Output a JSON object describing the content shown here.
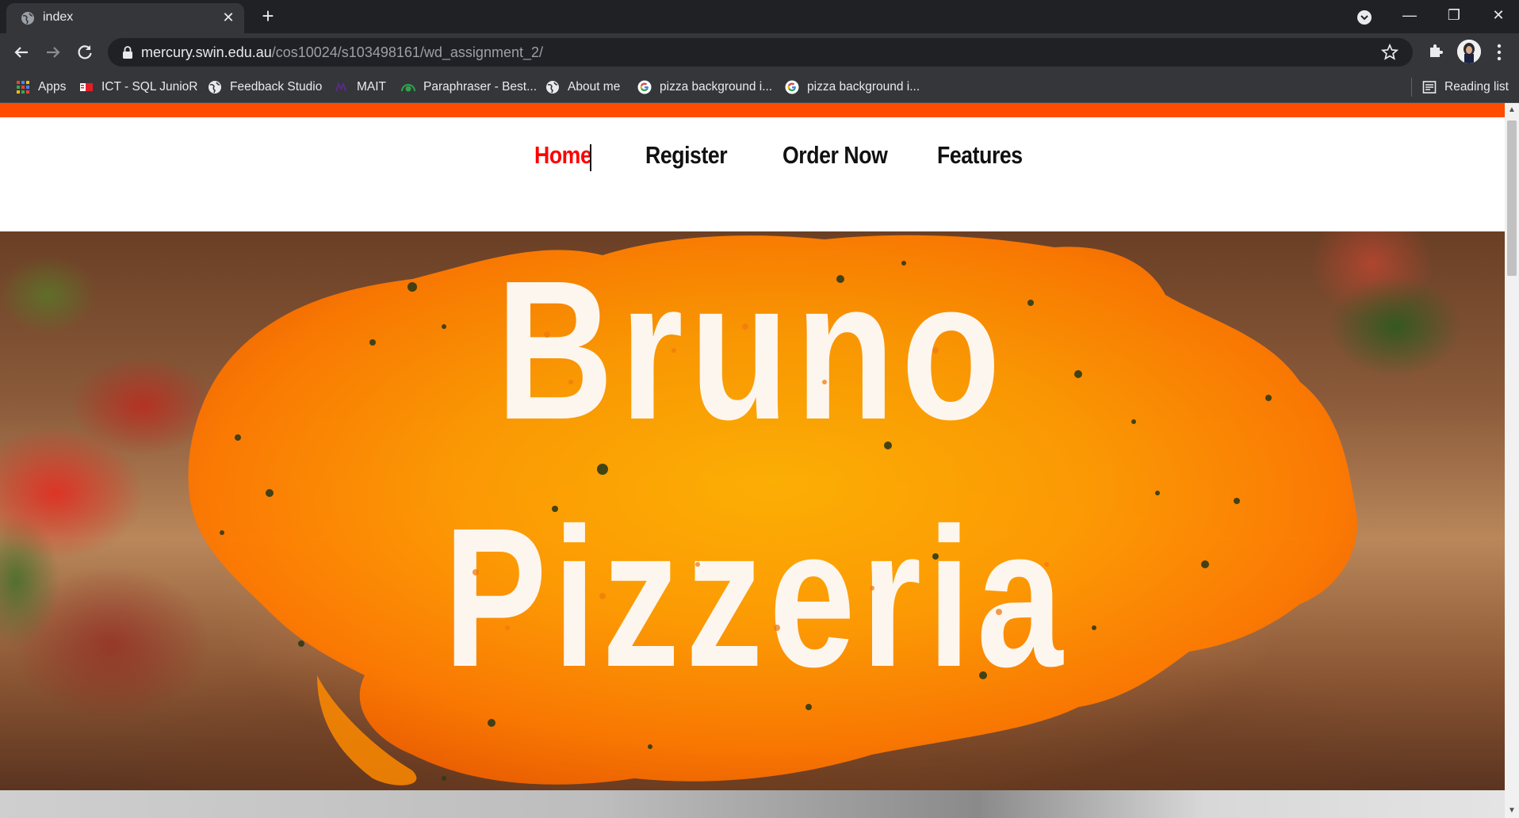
{
  "browser": {
    "tab": {
      "title": "index",
      "close_glyph": "✕"
    },
    "new_tab_glyph": "+",
    "window_controls": {
      "minimize": "—",
      "restore": "❐",
      "close": "✕"
    },
    "url": {
      "host": "mercury.swin.edu.au",
      "path": "/cos10024/s103498161/wd_assignment_2/"
    },
    "bookmarks": [
      {
        "label": "Apps",
        "icon": "apps-grid-icon"
      },
      {
        "label": "ICT - SQL JunioR",
        "icon": "ict-favicon"
      },
      {
        "label": "Feedback Studio",
        "icon": "globe-icon"
      },
      {
        "label": "MAIT",
        "icon": "mait-favicon"
      },
      {
        "label": "Paraphraser - Best...",
        "icon": "paraphraser-favicon"
      },
      {
        "label": "About me",
        "icon": "globe-icon"
      },
      {
        "label": "pizza background i...",
        "icon": "google-icon"
      },
      {
        "label": "pizza background i...",
        "icon": "google-icon"
      }
    ],
    "reading_list": "Reading list"
  },
  "site": {
    "nav": [
      {
        "label": "Home",
        "active": true
      },
      {
        "label": "Register",
        "active": false
      },
      {
        "label": "Order Now",
        "active": false
      },
      {
        "label": "Features",
        "active": false
      }
    ],
    "hero": {
      "line1": "Bruno",
      "line2": "Pizzeria"
    },
    "colors": {
      "accent_bar": "#ff4c00",
      "active_link": "#ff0000",
      "splash": "#ff8a00"
    }
  }
}
